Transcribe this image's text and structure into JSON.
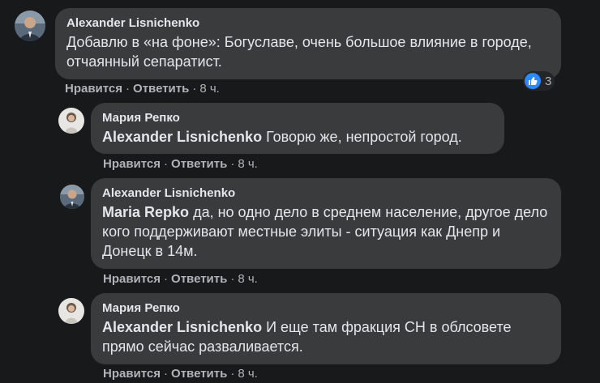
{
  "comments": [
    {
      "author": "Alexander Lisnichenko",
      "mention": "",
      "text": "Добавлю в «на фоне»: Богуславе, очень большое влияние в городе, отчаянный сепаратист.",
      "like_label": "Нравится",
      "reply_label": "Ответить",
      "time": "8 ч.",
      "reaction_count": "3",
      "reaction_icon": "like-icon"
    },
    {
      "author": "Мария Репко",
      "mention": "Alexander Lisnichenko",
      "text": "Говорю же, непростой город.",
      "like_label": "Нравится",
      "reply_label": "Ответить",
      "time": "8 ч."
    },
    {
      "author": "Alexander Lisnichenko",
      "mention": "Maria Repko",
      "text": "да, но одно дело в среднем население, другое дело кого поддерживают местные элиты - ситуация как Днепр и Донецк в 14м.",
      "like_label": "Нравится",
      "reply_label": "Ответить",
      "time": "8 ч."
    },
    {
      "author": "Мария Репко",
      "mention": "Alexander Lisnichenko",
      "text": "И еще там фракция СН в облсовете прямо сейчас разваливается.",
      "like_label": "Нравится",
      "reply_label": "Ответить",
      "time": "8 ч."
    }
  ],
  "separator": "·",
  "colors": {
    "background": "#18191a",
    "bubble": "#3a3b3c",
    "text": "#e4e6eb",
    "secondary_text": "#b0b3b8",
    "like_blue": "#2e89ff"
  }
}
